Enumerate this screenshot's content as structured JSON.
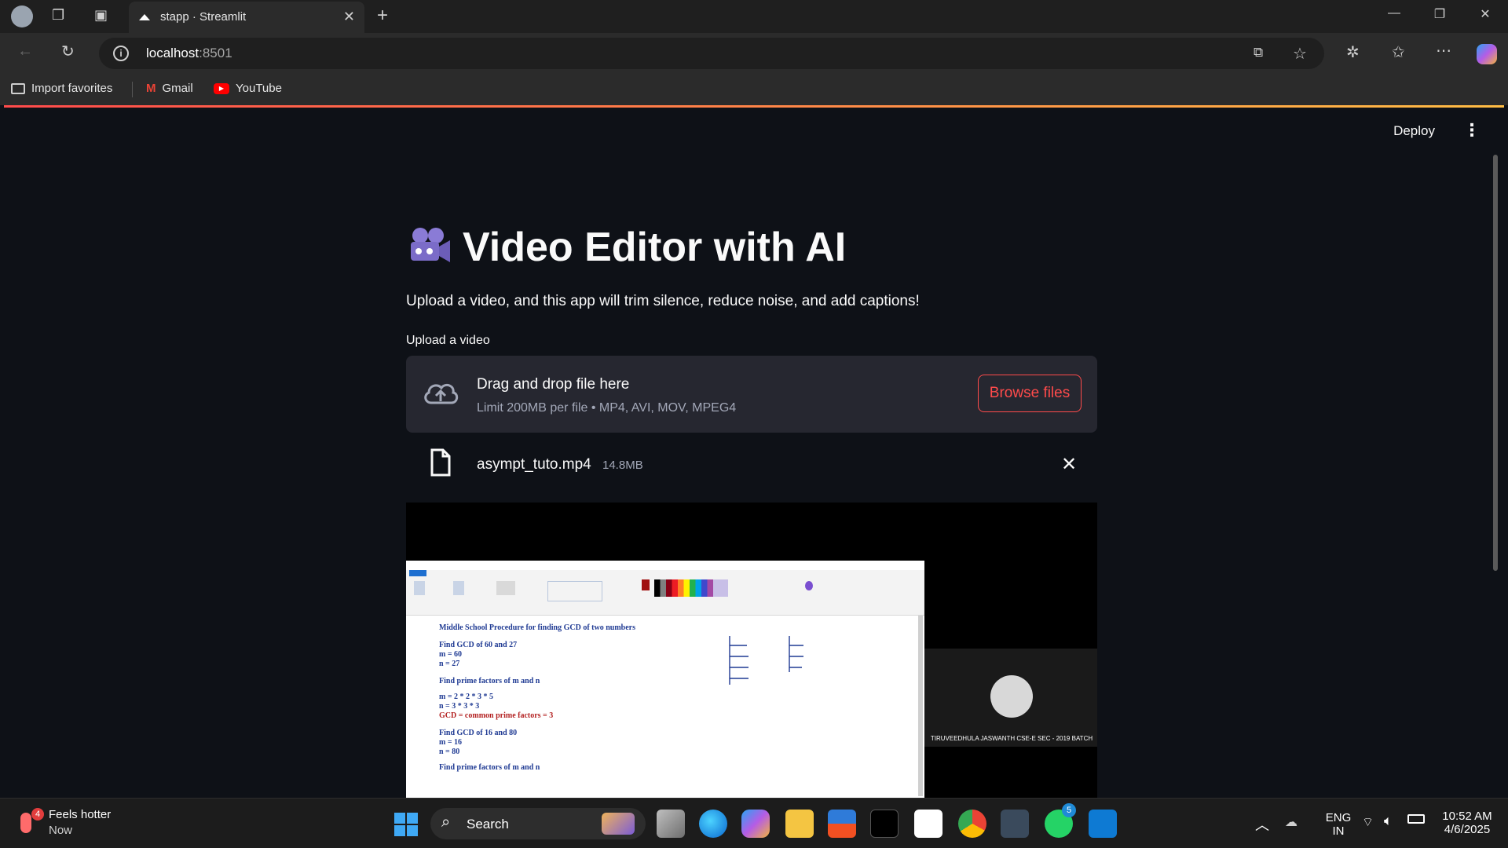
{
  "browser": {
    "tab_title": "stapp · Streamlit",
    "url_host": "localhost",
    "url_port": ":8501",
    "bookmarks": [
      "Import favorites",
      "Gmail",
      "YouTube"
    ]
  },
  "app": {
    "deploy_label": "Deploy",
    "title": "Video Editor with AI",
    "subtitle": "Upload a video, and this app will trim silence, reduce noise, and add captions!",
    "upload_label": "Upload a video",
    "dropzone": {
      "main_text": "Drag and drop file here",
      "limit_text": "Limit 200MB per file • MP4, AVI, MOV, MPEG4",
      "browse_label": "Browse files"
    },
    "uploaded_file": {
      "name": "asympt_tuto.mp4",
      "size": "14.8MB"
    },
    "video_frame": {
      "notes": [
        "Middle School Procedure for finding GCD of two numbers",
        "Find GCD of 60 and 27",
        "m = 60",
        "n = 27",
        "Find prime factors of m and n",
        "m = 2 * 2 * 3 * 5",
        "n = 3 * 3 * 3",
        "GCD = common prime factors = 3",
        "Find GCD of 16 and 80",
        "m = 16",
        "n = 80",
        "Find prime factors of m and n"
      ],
      "webcam_caption": "TIRUVEEDHULA JASWANTH CSE-E SEC - 2019 BATCH"
    }
  },
  "taskbar": {
    "weather_title": "Feels hotter",
    "weather_sub": "Now",
    "weather_badge": "4",
    "search_label": "Search",
    "whatsapp_badge": "5",
    "lang_1": "ENG",
    "lang_2": "IN",
    "time": "10:52 AM",
    "date": "4/6/2025"
  },
  "colors": {
    "accent_red": "#ff4b4b",
    "page_bg": "#0e1117",
    "dropzone_bg": "#262730"
  }
}
